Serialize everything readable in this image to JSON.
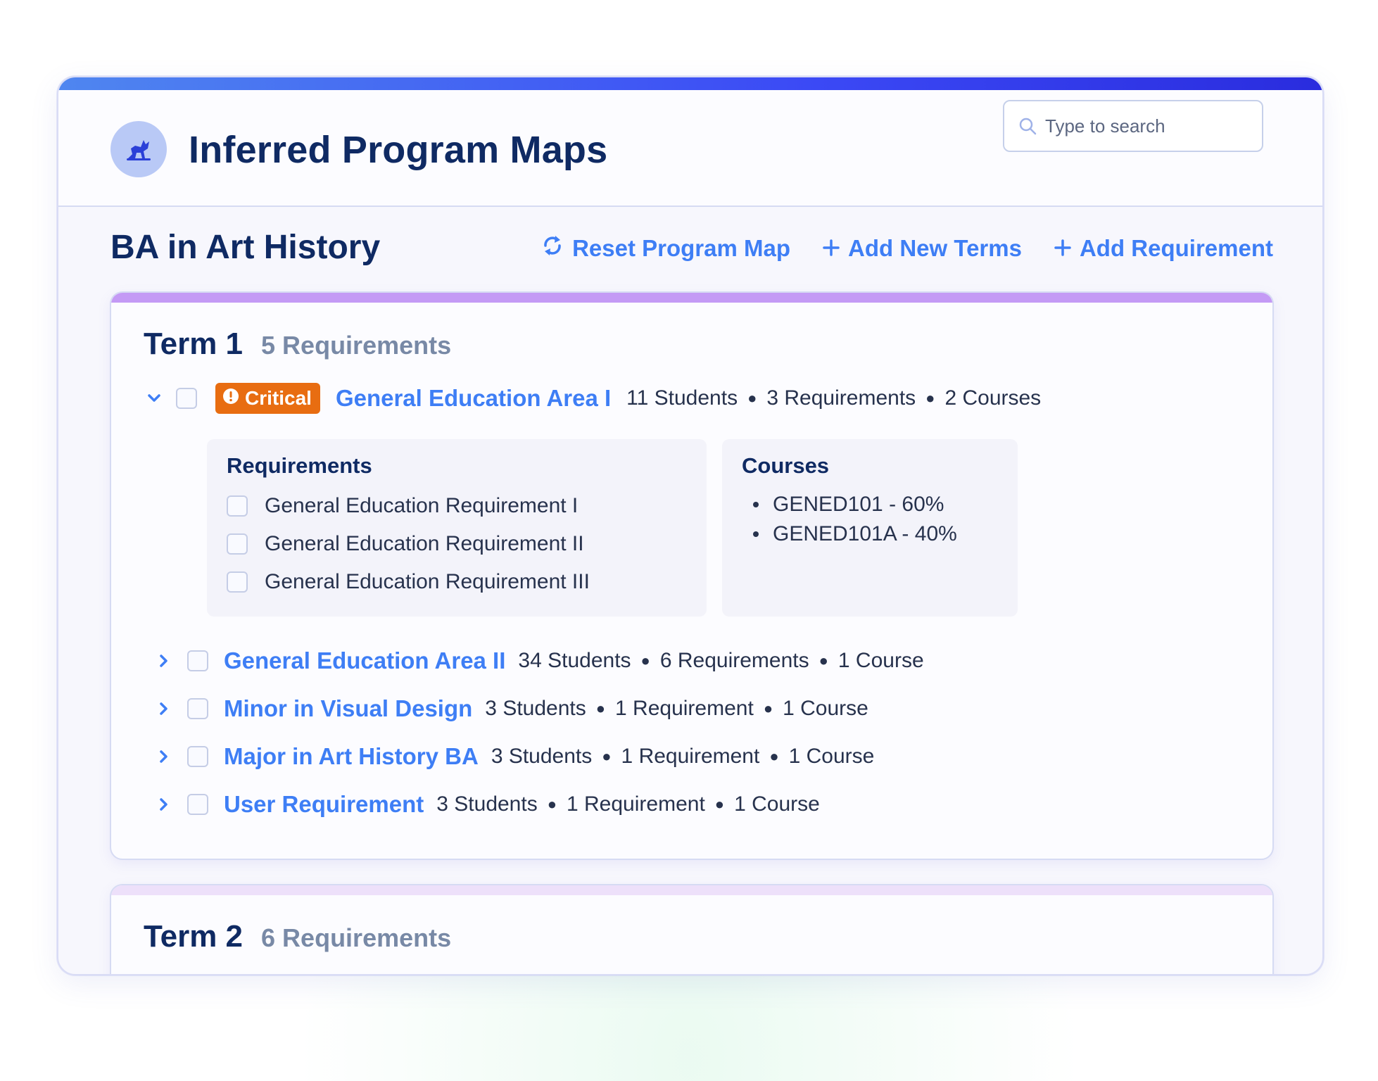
{
  "app": {
    "title": "Inferred Program Maps",
    "logo_icon": "wolf-logo-icon"
  },
  "search": {
    "placeholder": "Type to search",
    "value": ""
  },
  "program": {
    "title": "BA in Art History"
  },
  "actions": {
    "reset_label": "Reset Program Map",
    "add_terms_label": "Add New Terms",
    "add_requirement_label": "Add Requirement"
  },
  "terms": [
    {
      "name": "Term 1",
      "count": "5 Requirements",
      "requirements": [
        {
          "name": "General Education Area I",
          "expanded": true,
          "badge": "Critical",
          "students": "11 Students",
          "requirements": "3 Requirements",
          "courses": "2 Courses",
          "details": {
            "requirements_title": "Requirements",
            "requirement_items": [
              "General Education Requirement I",
              "General Education Requirement II",
              "General Education Requirement III"
            ],
            "courses_title": "Courses",
            "course_items": [
              "GENED101 - 60%",
              "GENED101A - 40%"
            ]
          }
        },
        {
          "name": "General Education Area II",
          "expanded": false,
          "students": "34 Students",
          "requirements": "6 Requirements",
          "courses": "1 Course"
        },
        {
          "name": "Minor in Visual Design",
          "expanded": false,
          "students": "3 Students",
          "requirements": "1 Requirement",
          "courses": "1 Course"
        },
        {
          "name": "Major in Art History BA",
          "expanded": false,
          "students": "3 Students",
          "requirements": "1 Requirement",
          "courses": "1 Course"
        },
        {
          "name": "User Requirement",
          "expanded": false,
          "students": "3 Students",
          "requirements": "1 Requirement",
          "courses": "1 Course"
        }
      ]
    },
    {
      "name": "Term 2",
      "count": "6 Requirements"
    }
  ],
  "colors": {
    "accent": "#3e7ef5",
    "heading": "#0f2a63",
    "critical": "#e86d11",
    "term1_stripe": "#c49af5",
    "term2_stripe": "#ede0fa"
  }
}
